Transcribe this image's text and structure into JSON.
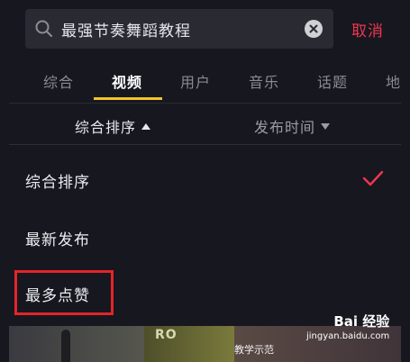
{
  "search": {
    "query": "最强节奏舞蹈教程",
    "cancel_label": "取消"
  },
  "tabs": [
    {
      "label": "综合"
    },
    {
      "label": "视频"
    },
    {
      "label": "用户"
    },
    {
      "label": "音乐"
    },
    {
      "label": "话题"
    },
    {
      "label": "地"
    }
  ],
  "active_tab": "视频",
  "sort_bar": {
    "sort_label": "综合排序",
    "time_label": "发布时间"
  },
  "sort_options": [
    {
      "label": "综合排序",
      "selected": true
    },
    {
      "label": "最新发布",
      "selected": false
    },
    {
      "label": "最多点赞",
      "selected": false
    }
  ],
  "results": {
    "thumb_text": "RO",
    "thumb_caption": "教学示范"
  },
  "watermark": {
    "logo": "Bai 经验",
    "url": "jingyan.baidu.com"
  },
  "colors": {
    "accent": "#f03550",
    "tab_underline": "#f5c32c",
    "highlight": "#e4242a"
  }
}
